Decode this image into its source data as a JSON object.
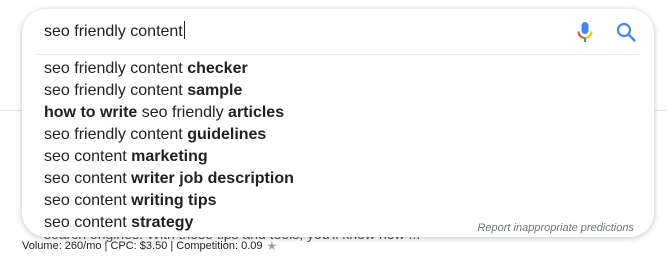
{
  "search": {
    "query": "seo friendly content"
  },
  "suggestions": [
    {
      "parts": [
        {
          "text": "seo friendly content ",
          "bold": false
        },
        {
          "text": "checker",
          "bold": true
        }
      ]
    },
    {
      "parts": [
        {
          "text": "seo friendly content ",
          "bold": false
        },
        {
          "text": "sample",
          "bold": true
        }
      ]
    },
    {
      "parts": [
        {
          "text": "how to write",
          "bold": true
        },
        {
          "text": " seo friendly ",
          "bold": false
        },
        {
          "text": "articles",
          "bold": true
        }
      ]
    },
    {
      "parts": [
        {
          "text": "seo friendly content ",
          "bold": false
        },
        {
          "text": "guidelines",
          "bold": true
        }
      ]
    },
    {
      "parts": [
        {
          "text": "seo content ",
          "bold": false
        },
        {
          "text": "marketing",
          "bold": true
        }
      ]
    },
    {
      "parts": [
        {
          "text": "seo content ",
          "bold": false
        },
        {
          "text": "writer job description",
          "bold": true
        }
      ]
    },
    {
      "parts": [
        {
          "text": "seo content ",
          "bold": false
        },
        {
          "text": "writing tips",
          "bold": true
        }
      ]
    },
    {
      "parts": [
        {
          "text": "seo content ",
          "bold": false
        },
        {
          "text": "strategy",
          "bold": true
        }
      ]
    }
  ],
  "report_link": "Report inappropriate predictions",
  "background": {
    "snippet": "search engines. With these tips and tools, you'll know how ...",
    "metrics": "Volume: 260/mo | CPC: $3.50 | Competition: 0.09"
  },
  "icons": {
    "mic": "microphone-icon",
    "search": "search-icon",
    "star": "star-icon"
  },
  "colors": {
    "mic_blue": "#4285f4",
    "mic_red": "#ea4335",
    "mic_yellow": "#fbbc05",
    "mic_green": "#34a853",
    "search_blue": "#4285f4"
  }
}
